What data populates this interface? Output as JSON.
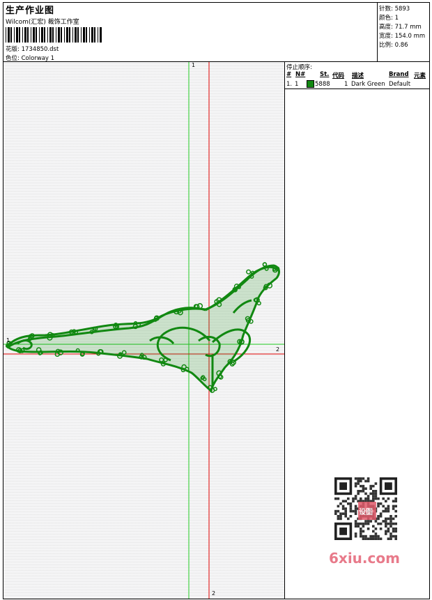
{
  "header": {
    "title": "生产作业图",
    "company": "Wilcom(汇宏) 裁饰工作室",
    "design_label": "花版:",
    "design_value": "1734850.dst",
    "colorway_label": "色位:",
    "colorway_value": "Colorway 1"
  },
  "stats": [
    {
      "label": "针数:",
      "value": "5893"
    },
    {
      "label": "颜色:",
      "value": "1"
    },
    {
      "label": "高度:",
      "value": "71.7 mm"
    },
    {
      "label": "宽度:",
      "value": "154.0 mm"
    },
    {
      "label": "比例:",
      "value": "0.86"
    }
  ],
  "guides": {
    "green_top": "1",
    "right_label": "2",
    "bottom_label": "2",
    "left_label": "1"
  },
  "panel": {
    "title": "停止顺序:",
    "columns": [
      "#",
      "N#",
      "St.",
      "代码",
      "描述",
      "Brand",
      "元素"
    ],
    "rows": [
      {
        "index": "1.",
        "n": "1",
        "stitches": "5888",
        "code": "1",
        "desc": "Dark Green",
        "brand": "Default",
        "color": "#118811"
      }
    ]
  },
  "watermark": {
    "text": "6xiu.com",
    "seal": "设图"
  },
  "colors": {
    "thread": "#118811",
    "guide_red": "#e00000",
    "guide_green": "#22cc22"
  }
}
